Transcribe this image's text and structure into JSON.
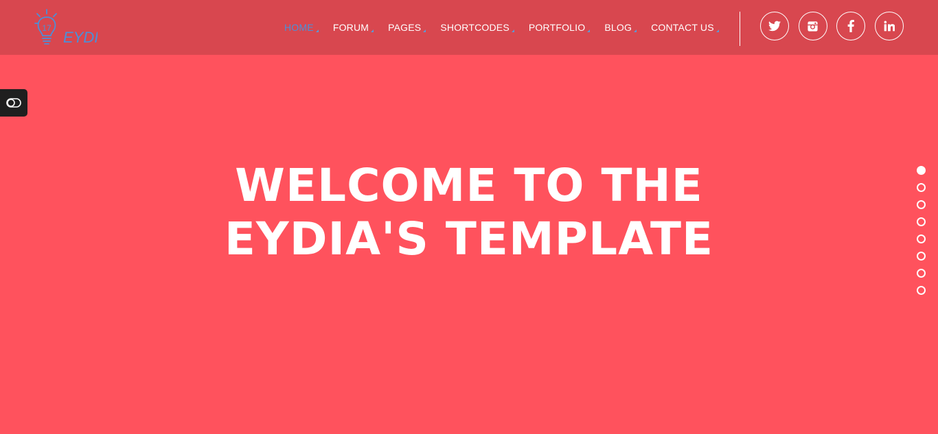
{
  "brand": {
    "logo_icon": "lightbulb-logo-icon",
    "logo_text": "EYDIA",
    "logo_number": "17"
  },
  "nav": {
    "items": [
      {
        "label": "HOME",
        "active": true
      },
      {
        "label": "FORUM",
        "active": false
      },
      {
        "label": "PAGES",
        "active": false
      },
      {
        "label": "SHORTCODES",
        "active": false
      },
      {
        "label": "PORTFOLIO",
        "active": false
      },
      {
        "label": "BLOG",
        "active": false
      },
      {
        "label": "CONTACT US",
        "active": false
      }
    ]
  },
  "social": [
    {
      "icon": "twitter-icon"
    },
    {
      "icon": "instagram-icon"
    },
    {
      "icon": "facebook-icon"
    },
    {
      "icon": "linkedin-icon"
    }
  ],
  "side_toggle": {
    "icon": "toggle-switch-icon"
  },
  "hero": {
    "title": "WELCOME TO THE EYDIA'S TEMPLATE"
  },
  "slider_dots": {
    "count": 8,
    "active_index": 0
  },
  "colors": {
    "header_bg": "#d8474f",
    "page_bg": "#ff525d",
    "accent": "#4a90d9",
    "text": "#ffffff",
    "toggle_bg": "#1f1f1f"
  }
}
